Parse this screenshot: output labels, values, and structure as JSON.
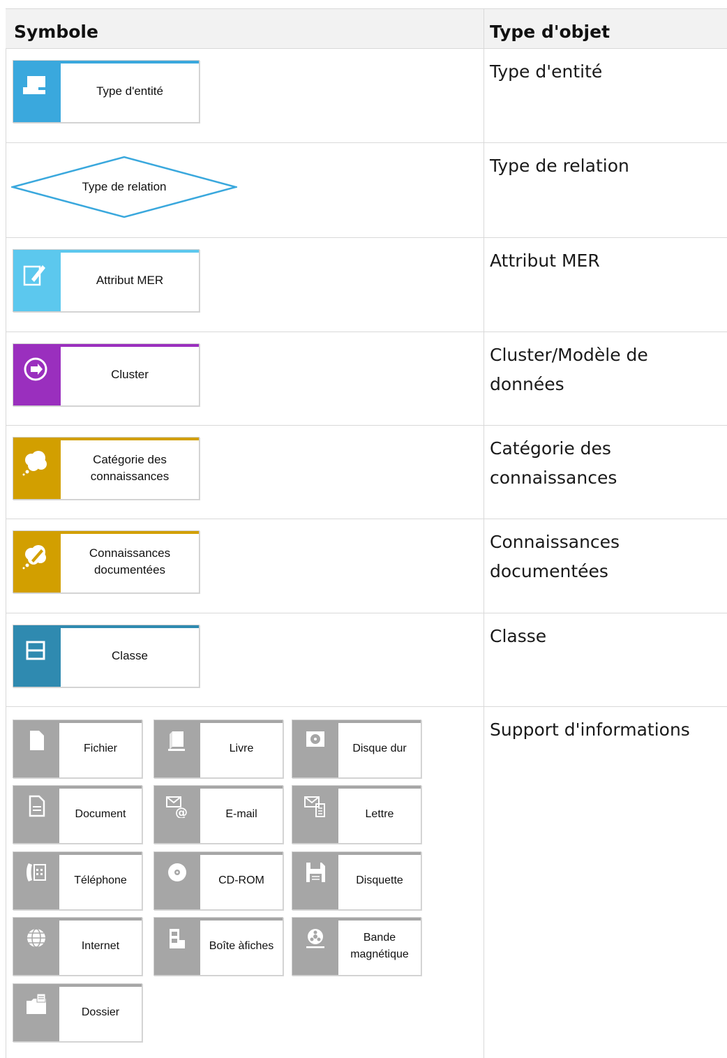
{
  "header": {
    "symbol": "Symbole",
    "type": "Type d'objet"
  },
  "rows": [
    {
      "type": "Type d'entité",
      "label": "Type d'entité",
      "color": "#3aa8dd",
      "icon": "entity-type-icon"
    },
    {
      "type": "Type de relation",
      "label": "Type de relation",
      "color": "#3aa8dd",
      "icon": "relation-diamond"
    },
    {
      "type": "Attribut MER",
      "label": "Attribut MER",
      "color": "#5cc8ee",
      "icon": "pen-edit-icon"
    },
    {
      "type": "Cluster/Modèle de données",
      "label": "Cluster",
      "color": "#9a2fbe",
      "icon": "cluster-icon"
    },
    {
      "type": "Catégorie des connaissances",
      "label": "Catégorie des connaissances",
      "color": "#d29f00",
      "icon": "thought-cloud-icon"
    },
    {
      "type": "Connaissances documentées",
      "label": "Connaissances documentées",
      "color": "#d29f00",
      "icon": "documented-knowledge-icon"
    },
    {
      "type": "Classe",
      "label": "Classe",
      "color": "#2f8ab0",
      "icon": "class-icon"
    },
    {
      "type": "Support d'informations"
    }
  ],
  "supports": [
    {
      "label": "Fichier",
      "icon": "file-icon"
    },
    {
      "label": "Livre",
      "icon": "book-icon"
    },
    {
      "label": "Disque dur",
      "icon": "hard-disk-icon"
    },
    {
      "label": "Document",
      "icon": "document-icon"
    },
    {
      "label": "E-mail",
      "icon": "email-icon"
    },
    {
      "label": "Lettre",
      "icon": "letter-icon"
    },
    {
      "label": "Téléphone",
      "icon": "telephone-icon"
    },
    {
      "label": "CD-ROM",
      "icon": "cd-rom-icon"
    },
    {
      "label": "Disquette",
      "icon": "floppy-disk-icon"
    },
    {
      "label": "Internet",
      "icon": "globe-icon"
    },
    {
      "label": "Boîte àfiches",
      "icon": "card-box-icon"
    },
    {
      "label": "Bande magnétique",
      "icon": "magnetic-tape-icon"
    },
    {
      "label": "Dossier",
      "icon": "folder-icon"
    }
  ]
}
